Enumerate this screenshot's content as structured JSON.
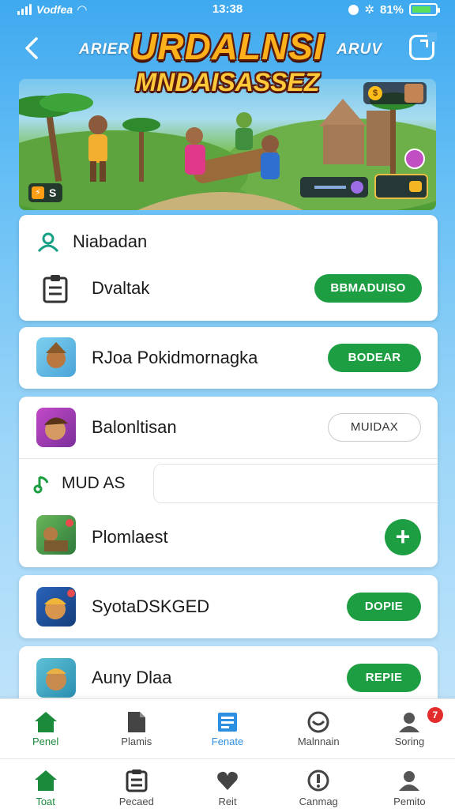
{
  "status_bar": {
    "carrier": "Vodfea",
    "time": "13:38",
    "battery": "81%",
    "battery_level": 0.81
  },
  "header": {
    "title_line1": "URDALNSI",
    "title_line2": "MNDAISASSEZ",
    "left_tag": "ARIER",
    "right_tag": "ARUV",
    "back_icon": "chevron-left-icon",
    "share_icon": "share-icon"
  },
  "banner": {
    "badge_text": "S",
    "colors": {
      "sky": "#79c6ee",
      "grass": "#4c9b35"
    }
  },
  "section": {
    "header_label": "Niabadan",
    "header_icon": "users-icon",
    "row_label": "Dvaltak",
    "row_icon": "clipboard-icon",
    "row_button": "BBMADUISO"
  },
  "list": [
    {
      "label": "RJoa Pokidmornagka",
      "button": "BODEAR",
      "style": "green"
    },
    {
      "label": "Balonltisan",
      "button": "MUIDAX",
      "style": "outline"
    },
    {
      "label": "Plomlaest",
      "button": "+",
      "style": "plus"
    },
    {
      "label": "SyotaDSKGED",
      "button": "DOPIE",
      "style": "green"
    },
    {
      "label": "Auny Dlaa",
      "button": "REPIE",
      "style": "green"
    }
  ],
  "subsection": {
    "label": "MUD AS",
    "icon": "music-note-icon"
  },
  "tabbar_top": [
    {
      "label": "Penel",
      "icon": "home-icon",
      "active": true
    },
    {
      "label": "Plamis",
      "icon": "document-icon",
      "active": false
    },
    {
      "label": "Fenate",
      "icon": "news-icon",
      "active": false,
      "accent": true
    },
    {
      "label": "Malnnain",
      "icon": "gamepad-icon",
      "active": false
    },
    {
      "label": "Soring",
      "icon": "profile-icon",
      "active": false,
      "badge": "7"
    }
  ],
  "tabbar_bottom": [
    {
      "label": "Toat",
      "icon": "home-icon",
      "active": true
    },
    {
      "label": "Pecaed",
      "icon": "clipboard-icon"
    },
    {
      "label": "Reit",
      "icon": "heart-icon"
    },
    {
      "label": "Canmag",
      "icon": "alert-icon"
    },
    {
      "label": "Pemito",
      "icon": "profile-icon"
    }
  ],
  "colors": {
    "accent_green": "#1e9e43",
    "active_tab_green": "#1b8a3a",
    "accent_blue": "#2d8fe0",
    "badge_red": "#e32c2c",
    "title_orange": "#ffb11b"
  }
}
